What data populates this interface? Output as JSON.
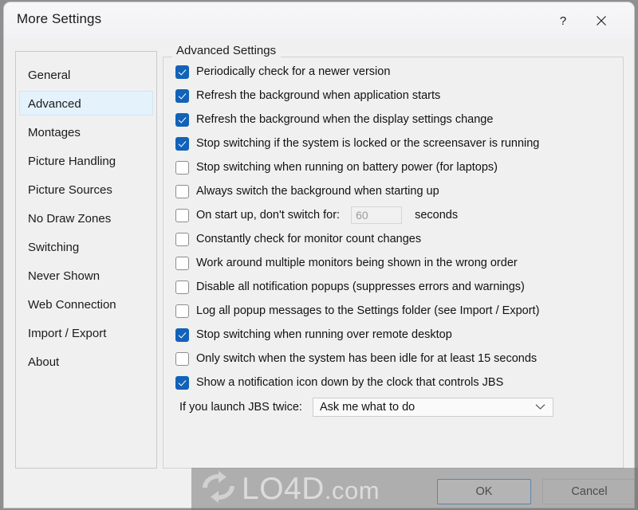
{
  "window": {
    "title": "More Settings",
    "help_icon": "question-mark-icon",
    "close_icon": "close-icon"
  },
  "sidebar": {
    "items": [
      {
        "label": "General",
        "selected": false
      },
      {
        "label": "Advanced",
        "selected": true
      },
      {
        "label": "Montages",
        "selected": false
      },
      {
        "label": "Picture Handling",
        "selected": false
      },
      {
        "label": "Picture Sources",
        "selected": false
      },
      {
        "label": "No Draw Zones",
        "selected": false
      },
      {
        "label": "Switching",
        "selected": false
      },
      {
        "label": "Never Shown",
        "selected": false
      },
      {
        "label": "Web Connection",
        "selected": false
      },
      {
        "label": "Import / Export",
        "selected": false
      },
      {
        "label": "About",
        "selected": false
      }
    ]
  },
  "group": {
    "title": "Advanced Settings",
    "checkboxes": [
      {
        "label": "Periodically check for a newer version",
        "checked": true
      },
      {
        "label": "Refresh the background when application starts",
        "checked": true
      },
      {
        "label": "Refresh the background when the display settings change",
        "checked": true
      },
      {
        "label": "Stop switching if the system is locked or the screensaver is running",
        "checked": true
      },
      {
        "label": "Stop switching when running on battery power (for laptops)",
        "checked": false
      },
      {
        "label": "Always switch the background when starting up",
        "checked": false
      },
      {
        "label": "On start up, don't switch for:",
        "checked": false,
        "input": "60",
        "unit": "seconds"
      },
      {
        "label": "Constantly check for monitor count changes",
        "checked": false
      },
      {
        "label": "Work around multiple monitors being shown in the wrong order",
        "checked": false
      },
      {
        "label": "Disable all notification popups (suppresses errors and warnings)",
        "checked": false
      },
      {
        "label": "Log all popup messages to the Settings folder (see Import / Export)",
        "checked": false
      },
      {
        "label": "Stop switching when running over remote desktop",
        "checked": true
      },
      {
        "label": "Only switch when the system has been idle for at least 15 seconds",
        "checked": false
      },
      {
        "label": "Show a notification icon down by the clock that controls JBS",
        "checked": true
      }
    ],
    "dropdown": {
      "label": "If you launch JBS twice:",
      "value": "Ask me what to do",
      "arrow_icon": "chevron-down-icon"
    }
  },
  "footer": {
    "ok_label": "OK",
    "cancel_label": "Cancel"
  },
  "watermark": {
    "text": "LO4D",
    "suffix": ".com",
    "logo_icon": "refresh-circular-arrows-icon"
  },
  "colors": {
    "accent_checkbox": "#1262b8",
    "selection_bg": "#e4f2fc",
    "selection_border": "#cfe6f5",
    "window_bg": "#f0f0f0",
    "focus_border": "#3e92dd"
  }
}
